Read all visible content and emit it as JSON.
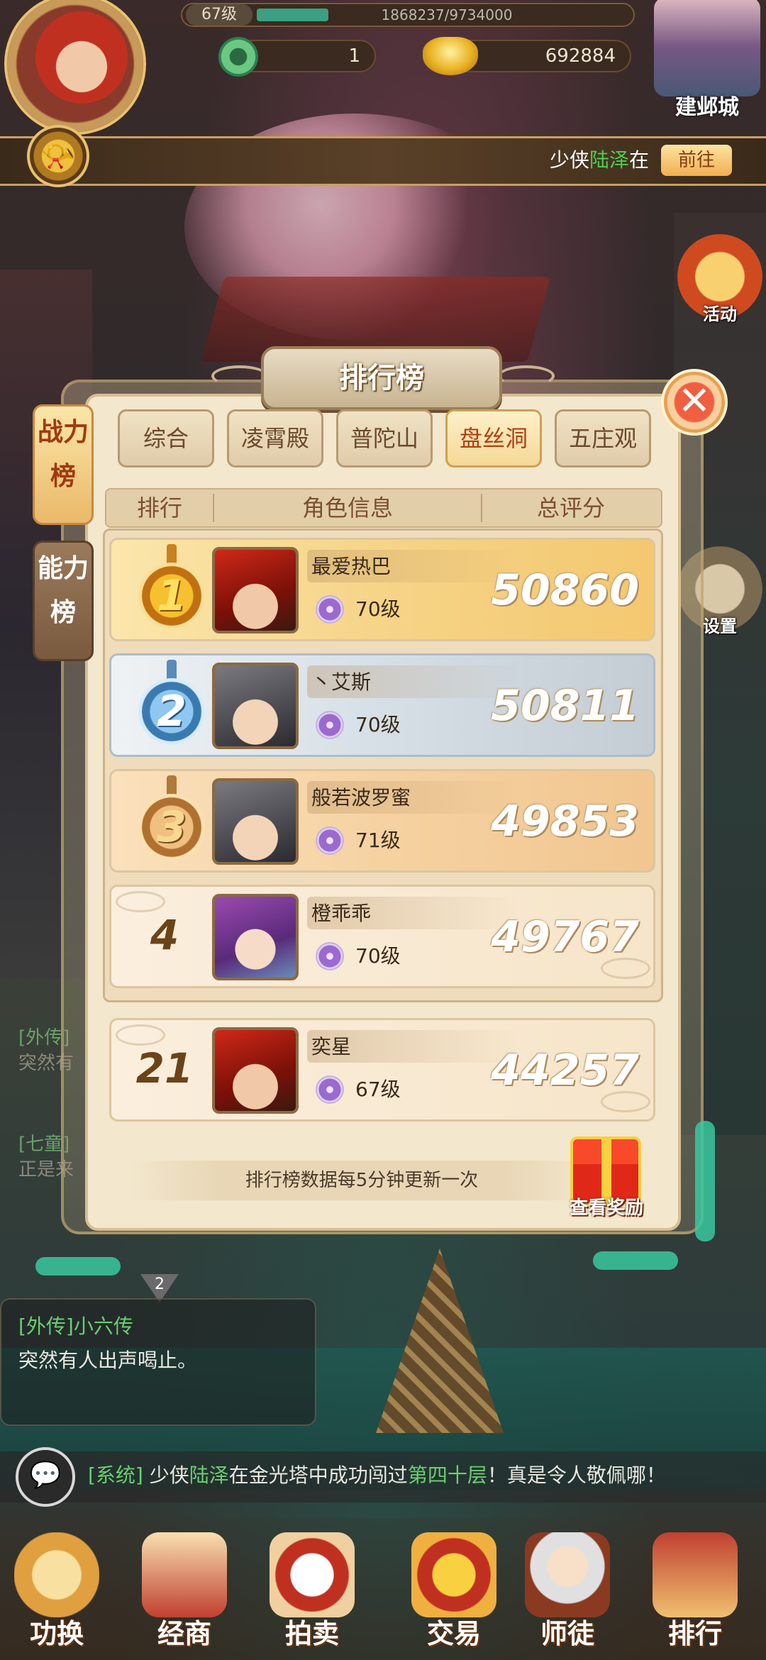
{
  "hud": {
    "level": "67级",
    "exp_text": "1868237/9734000",
    "exp_fraction": 0.19,
    "jade": "1",
    "gold": "692884",
    "city_label": "建邺城"
  },
  "notice": {
    "prefix": "少侠",
    "name": "陆泽",
    "suffix": "在",
    "goto_label": "前往"
  },
  "side_buttons": {
    "activity": "活动",
    "settings": "设置"
  },
  "panel": {
    "title": "排行榜",
    "close_symbol": "✕",
    "side_tabs": [
      {
        "label_line1": "战力",
        "label_line2": "榜",
        "active": true
      },
      {
        "label_line1": "能力",
        "label_line2": "榜",
        "active": false
      }
    ],
    "faction_tabs": [
      "综合",
      "凌霄殿",
      "普陀山",
      "盘丝洞",
      "五庄观"
    ],
    "active_faction_index": 3,
    "columns": {
      "rank": "排行",
      "info": "角色信息",
      "score": "总评分"
    },
    "rows": [
      {
        "rank": "1",
        "name": "最爱热巴",
        "level": "70级",
        "score": "50860"
      },
      {
        "rank": "2",
        "name": "丶艾斯",
        "level": "70级",
        "score": "50811"
      },
      {
        "rank": "3",
        "name": "般若波罗蜜",
        "level": "71级",
        "score": "49853"
      },
      {
        "rank": "4",
        "name": "橙乖乖",
        "level": "70级",
        "score": "49767"
      }
    ],
    "my_row": {
      "rank": "21",
      "name": "奕星",
      "level": "67级",
      "score": "44257"
    },
    "update_note": "排行榜数据每5分钟更新一次",
    "reward_label": "查看奖励"
  },
  "chat_bg": [
    {
      "tag": "[外传]",
      "text": "突然有"
    },
    {
      "tag": "[七童]",
      "text": "正是来"
    }
  ],
  "chat": {
    "badge": "2",
    "tag": "[外传]小六传",
    "message": "突然有人出声喝止。"
  },
  "system_message": {
    "icon": "💬",
    "tag": "[系统]",
    "part1": "少侠",
    "name": "陆泽",
    "part2": "在金光塔中成功闯过",
    "floor": "第四十层",
    "part3": "！真是令人敬佩哪！"
  },
  "bottom_nav": [
    "功换",
    "经商",
    "拍卖",
    "交易",
    "师徒",
    "排行"
  ],
  "colors": {
    "highlight_green": "#4ad050",
    "panel_bg": "#f3e7cd",
    "close_red": "#f06040"
  }
}
